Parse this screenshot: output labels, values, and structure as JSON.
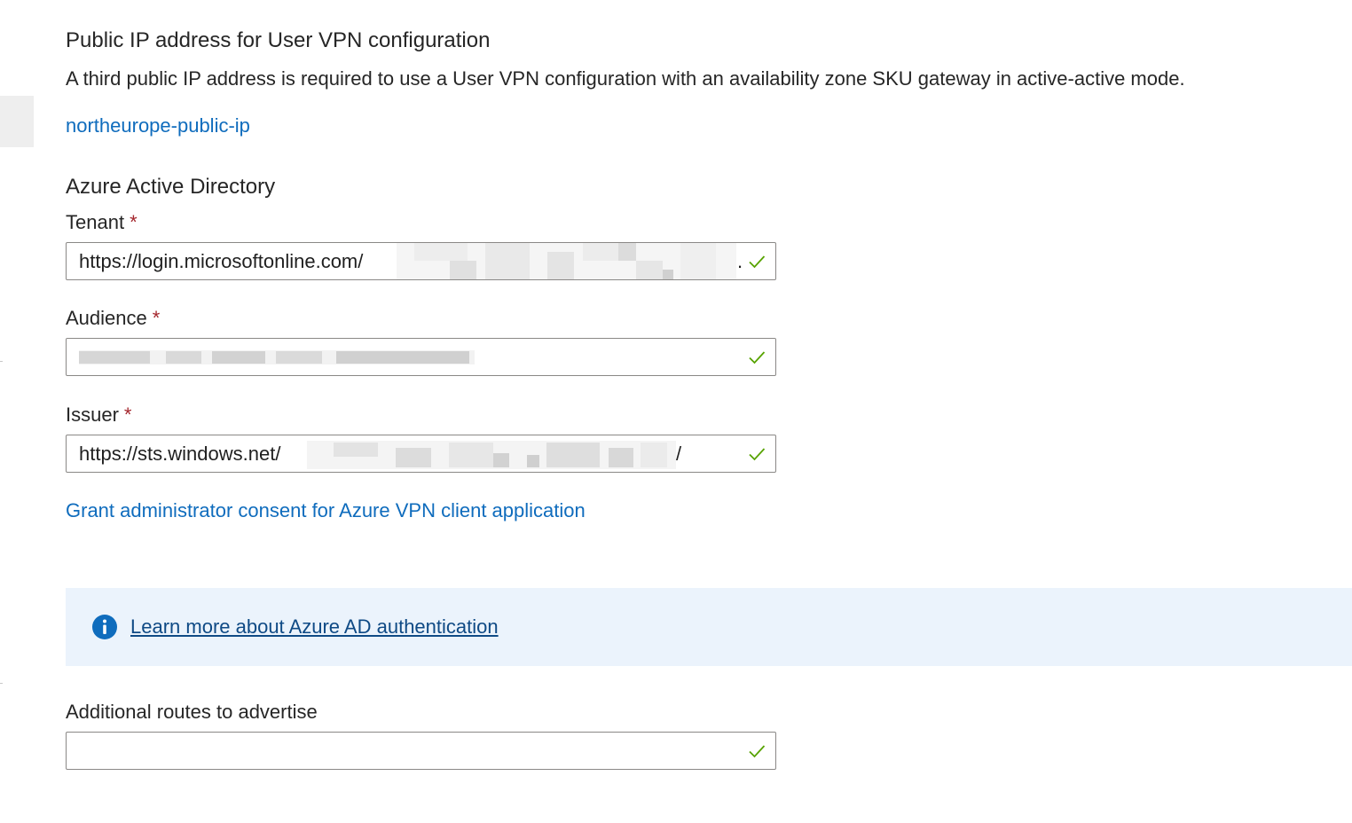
{
  "public_ip": {
    "heading": "Public IP address for User VPN configuration",
    "description": "A third public IP address is required to use a User VPN configuration with an availability zone SKU gateway in active-active mode.",
    "link": "northeurope-public-ip"
  },
  "aad": {
    "heading": "Azure Active Directory",
    "required_marker": "*",
    "tenant": {
      "label": "Tenant",
      "value_prefix": "https://login.microsoftonline.com/",
      "value_suffix": "."
    },
    "audience": {
      "label": "Audience"
    },
    "issuer": {
      "label": "Issuer",
      "value_prefix": "https://sts.windows.net/",
      "value_suffix": "/"
    },
    "consent_link": "Grant administrator consent for Azure VPN client application"
  },
  "info_banner": {
    "icon": "info-icon",
    "link": "Learn more about Azure AD authentication"
  },
  "routes": {
    "label": "Additional routes to advertise",
    "value": ""
  },
  "colors": {
    "link": "#0f6cbd",
    "banner_bg": "#ebf3fc",
    "info_icon": "#0f6cbd",
    "valid_check": "#57a300",
    "required": "#a4262c"
  }
}
